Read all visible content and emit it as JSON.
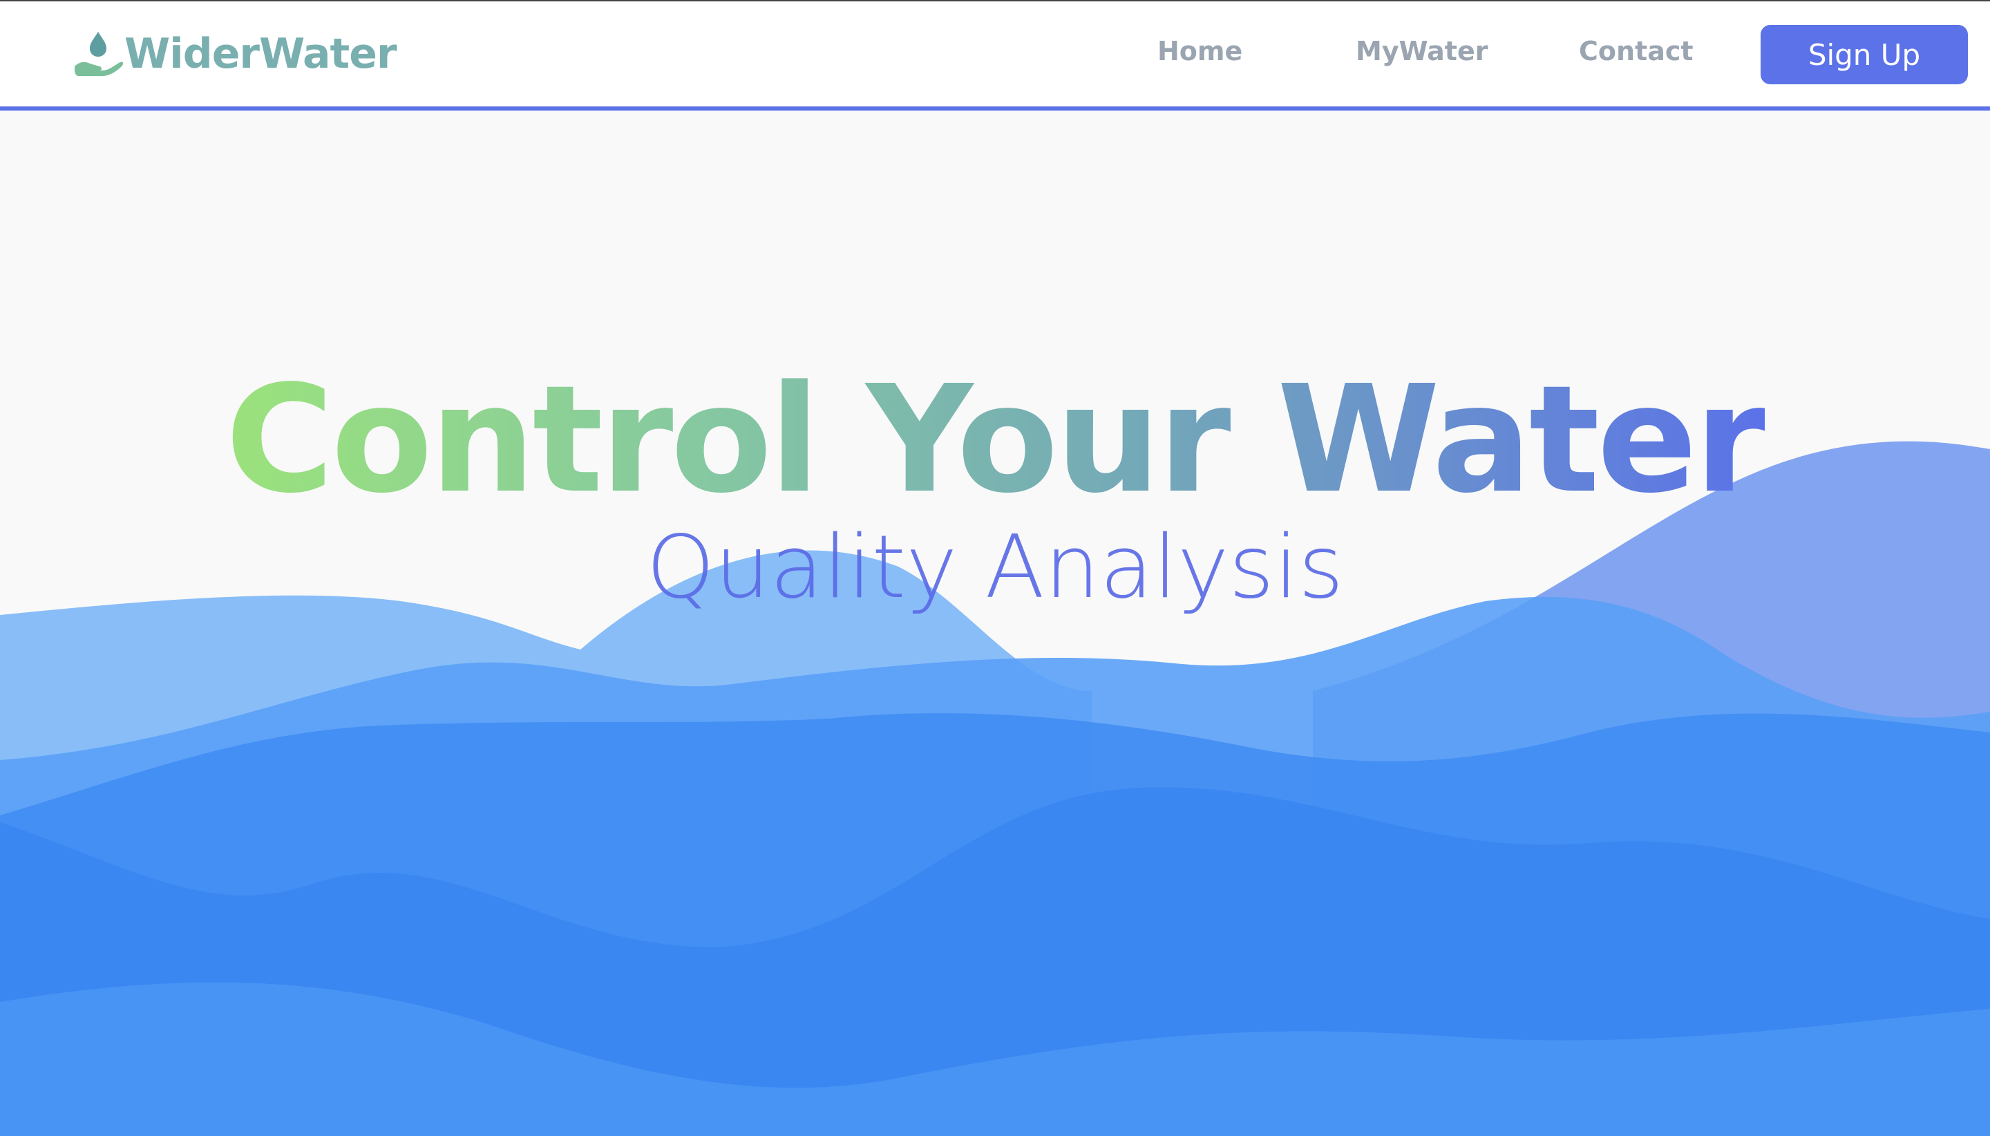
{
  "brand": {
    "name": "WiderWater",
    "icon": "water-drop-hand-icon",
    "color": "#7aafb0"
  },
  "nav": {
    "links": [
      {
        "label": "Home"
      },
      {
        "label": "MyWater"
      },
      {
        "label": "Contact"
      }
    ],
    "signup_label": "Sign Up",
    "accent": "#5b72e8"
  },
  "hero": {
    "title": "Control Your Water",
    "subtitle": "Quality Analysis",
    "title_gradient": [
      "#9be27c",
      "#73a8b8",
      "#5b72e8"
    ],
    "subtitle_color": "#5b6be6",
    "wave_color": "#3d8bf5"
  }
}
